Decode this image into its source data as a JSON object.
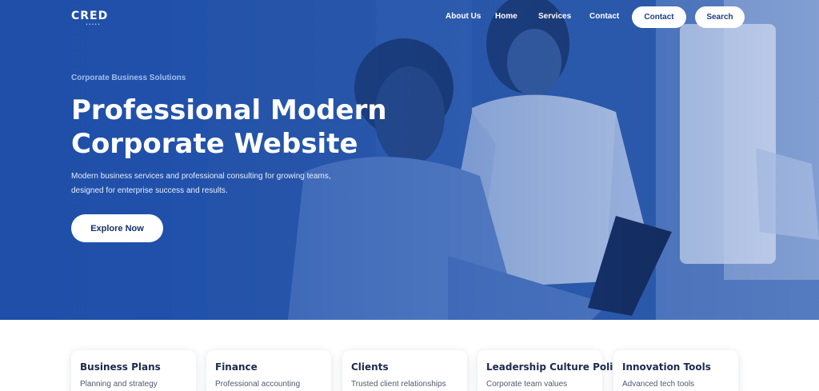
{
  "nav": {
    "logo_text": "CRED",
    "logo_sub": "•••••",
    "links": [
      "About Us",
      "Home",
      "Services",
      "Contact"
    ],
    "btn_primary": "Contact",
    "btn_secondary": "Search"
  },
  "hero": {
    "eyebrow": "Corporate Business Solutions",
    "title_line1": "Professional Modern",
    "title_line2": "Corporate Website",
    "desc_line1": "Modern business services and professional consulting for growing teams,",
    "desc_line2": "designed for enterprise success and results.",
    "cta": "Explore Now"
  },
  "cards": [
    {
      "title": "Business Plans",
      "desc": "Planning and strategy"
    },
    {
      "title": "Finance",
      "desc": "Professional accounting"
    },
    {
      "title": "Clients",
      "desc": "Trusted client relationships"
    },
    {
      "title": "Leadership Culture Policy",
      "desc": "Corporate team values"
    },
    {
      "title": "Innovation Tools",
      "desc": "Advanced tech tools"
    }
  ],
  "colors": {
    "hero_dark": "#1f4fa8",
    "hero_light": "#5a86cf",
    "button_bg": "#ffffff",
    "button_text": "#1d3f86",
    "card_title": "#1c2a4e"
  }
}
